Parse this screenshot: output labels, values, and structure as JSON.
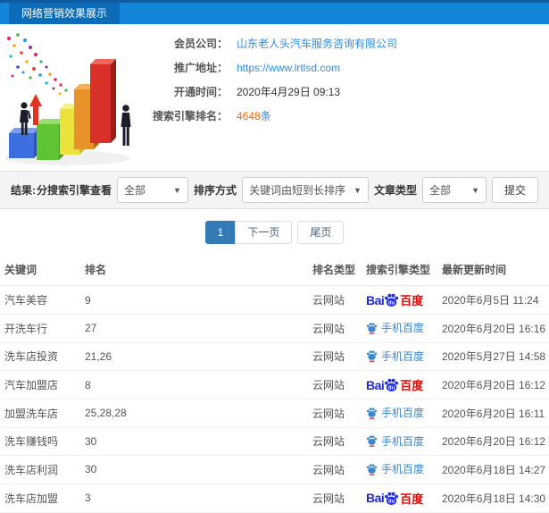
{
  "header": {
    "title": "网络营销效果展示"
  },
  "info": {
    "rows": [
      {
        "label": "会员公司：",
        "value": "山东老人头汽车服务咨询有限公司"
      },
      {
        "label": "推广地址：",
        "value": "https://www.lrtlsd.com"
      },
      {
        "label": "开通时间：",
        "value": "2020年4月29日 09:13"
      },
      {
        "label": "搜索引擎排名：",
        "value": "4648",
        "suffix": "条"
      }
    ]
  },
  "filters": {
    "result_label": "结果:",
    "engine_label": "分搜索引擎查看",
    "engine_value": "全部",
    "sort_label": "排序方式",
    "sort_value": "关键词由短到长排序",
    "article_label": "文章类型",
    "article_value": "全部",
    "submit_label": "提交"
  },
  "pagination": {
    "current": "1",
    "next": "下一页",
    "last": "尾页"
  },
  "table": {
    "headers": [
      "关键词",
      "排名",
      "排名类型",
      "搜索引擎类型",
      "最新更新时间"
    ],
    "engine_labels": {
      "baidu_bai": "Bai",
      "baidu_du": "du",
      "baidu_cn": "百度",
      "mobile_cn": "手机百度"
    },
    "rows": [
      {
        "keyword": "汽车美容",
        "rank": "9",
        "rank_type": "云网站",
        "engine": "baidu",
        "updated": "2020年6月5日 11:24"
      },
      {
        "keyword": "开洗车行",
        "rank": "27",
        "rank_type": "云网站",
        "engine": "mobile-baidu",
        "updated": "2020年6月20日 16:16"
      },
      {
        "keyword": "洗车店投资",
        "rank": "21,26",
        "rank_type": "云网站",
        "engine": "mobile-baidu",
        "updated": "2020年5月27日 14:58"
      },
      {
        "keyword": "汽车加盟店",
        "rank": "8",
        "rank_type": "云网站",
        "engine": "baidu",
        "updated": "2020年6月20日 16:12"
      },
      {
        "keyword": "加盟洗车店",
        "rank": "25,28,28",
        "rank_type": "云网站",
        "engine": "mobile-baidu",
        "updated": "2020年6月20日 16:11"
      },
      {
        "keyword": "洗车赚钱吗",
        "rank": "30",
        "rank_type": "云网站",
        "engine": "mobile-baidu",
        "updated": "2020年6月20日 16:12"
      },
      {
        "keyword": "洗车店利润",
        "rank": "30",
        "rank_type": "云网站",
        "engine": "mobile-baidu",
        "updated": "2020年6月18日 14:27"
      },
      {
        "keyword": "洗车店加盟",
        "rank": "3",
        "rank_type": "云网站",
        "engine": "baidu",
        "updated": "2020年6月18日 14:30"
      }
    ]
  },
  "colors": {
    "header_bg": "#1486d9",
    "header_tab_bg": "#0c6cb8",
    "link_blue": "#2e8ded",
    "rank_blue": "#3a8ee6",
    "highlight_orange": "#ff6600",
    "pagination_active": "#337ab7",
    "baidu_blue": "#2430e0",
    "baidu_red": "#e10602"
  }
}
